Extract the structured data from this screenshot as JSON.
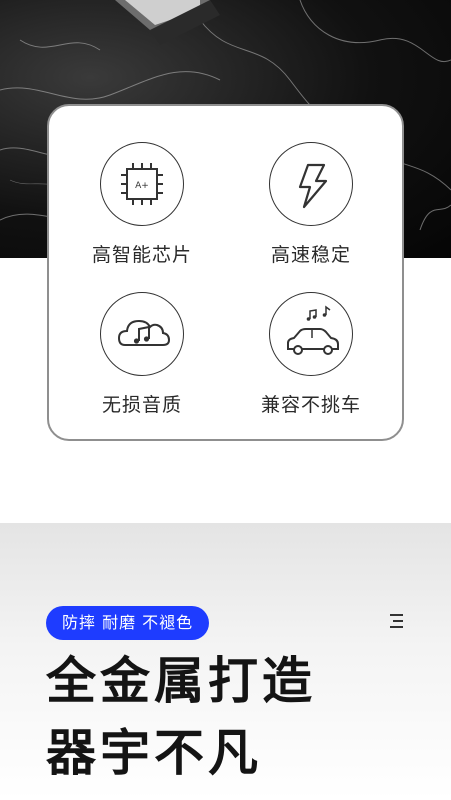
{
  "features": [
    {
      "label": "高智能芯片",
      "icon": "chip-icon",
      "chip_text": "A+"
    },
    {
      "label": "高速稳定",
      "icon": "lightning-icon"
    },
    {
      "label": "无损音质",
      "icon": "cloud-music-icon"
    },
    {
      "label": "兼容不挑车",
      "icon": "car-music-icon"
    }
  ],
  "badge": {
    "label": "防摔 耐磨 不褪色",
    "color": "#1e3cff"
  },
  "headline": {
    "line1": "全金属打造",
    "line2": "器宇不凡"
  },
  "menu": {
    "icon": "menu-icon"
  }
}
